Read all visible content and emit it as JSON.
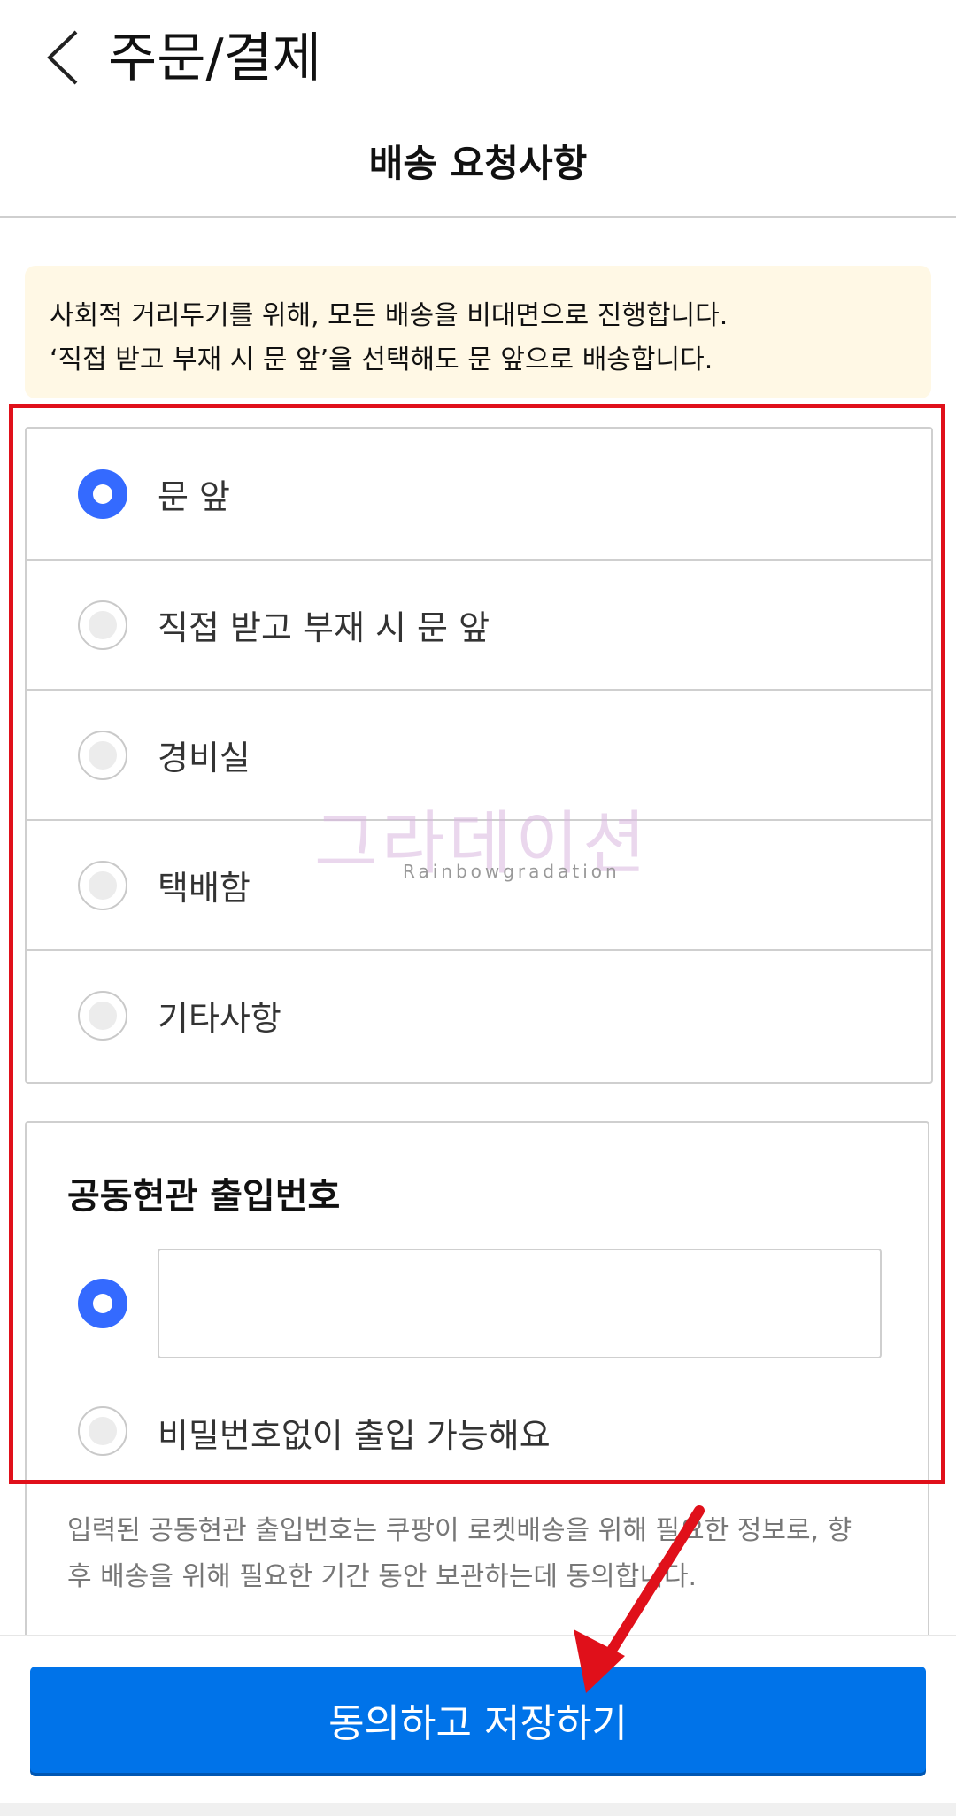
{
  "header": {
    "title": "주문/결제",
    "section_title": "배송 요청사항"
  },
  "notice": {
    "line1": "사회적 거리두기를 위해, 모든 배송을 비대면으로 진행합니다.",
    "line2": "‘직접 받고 부재 시 문 앞’을 선택해도 문 앞으로 배송합니다."
  },
  "options": [
    {
      "label": "문 앞",
      "selected": true
    },
    {
      "label": "직접 받고 부재 시 문 앞",
      "selected": false
    },
    {
      "label": "경비실",
      "selected": false
    },
    {
      "label": "택배함",
      "selected": false
    },
    {
      "label": "기타사항",
      "selected": false
    }
  ],
  "entry": {
    "title": "공동현관 출입번호",
    "input_value": "",
    "no_password_label": "비밀번호없이 출입 가능해요",
    "consent_line1": "입력된 공동현관 출입번호는 쿠팡이 로켓배송을 위해 필요한 정보로, 향",
    "consent_line2": "후 배송을 위해 필요한 기간 동안 보관하는데 동의합니다."
  },
  "watermark": {
    "main": "그라데이션",
    "sub": "Rainbowgradation"
  },
  "footer": {
    "save_label": "동의하고 저장하기"
  },
  "colors": {
    "accent": "#346aff",
    "button": "#0073e9",
    "highlight": "#e0101a",
    "notice_bg": "#fff8e5"
  }
}
